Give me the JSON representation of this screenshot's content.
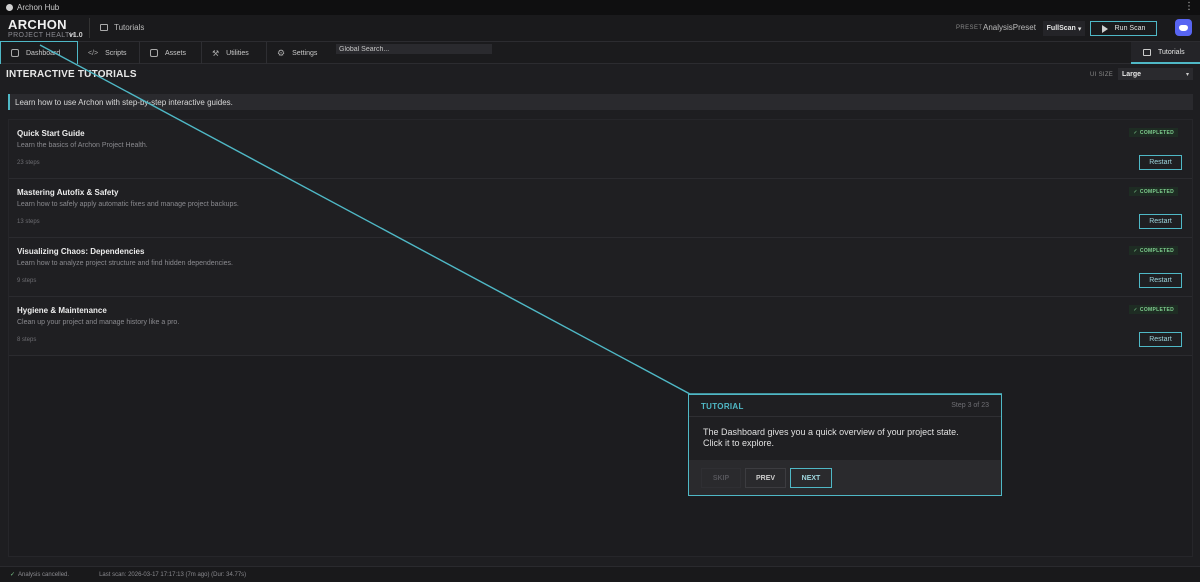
{
  "window": {
    "title": "Archon Hub",
    "menu_icon": "more-vert-icon"
  },
  "header": {
    "app_name": "ARCHON",
    "app_sub": "PROJECT HEALTH",
    "version": "v1.0",
    "breadcrumb": "Tutorials",
    "preset_label": "PRESET",
    "preset_value": "AnalysisPreset",
    "scan_mode": "FullScan",
    "run_scan_label": "Run Scan"
  },
  "nav": {
    "tabs": [
      {
        "label": "Dashboard",
        "icon": "dashboard-icon",
        "active": true
      },
      {
        "label": "Scripts",
        "icon": "code-icon"
      },
      {
        "label": "Assets",
        "icon": "cube-icon"
      },
      {
        "label": "Utilities",
        "icon": "wrench-icon"
      },
      {
        "label": "Settings",
        "icon": "gear-icon"
      }
    ],
    "search_placeholder": "Global Search...",
    "right_tab": "Tutorials"
  },
  "page": {
    "title": "INTERACTIVE TUTORIALS",
    "ui_size_label": "UI SIZE",
    "ui_size_value": "Large",
    "intro": "Learn how to use Archon with step-by-step interactive guides."
  },
  "tutorials": [
    {
      "title": "Quick Start Guide",
      "desc": "Learn the basics of Archon Project Health.",
      "steps": "23 steps",
      "status": "COMPLETED",
      "action": "Restart"
    },
    {
      "title": "Mastering Autofix & Safety",
      "desc": "Learn how to safely apply automatic fixes and manage project backups.",
      "steps": "13 steps",
      "status": "COMPLETED",
      "action": "Restart"
    },
    {
      "title": "Visualizing Chaos: Dependencies",
      "desc": "Learn how to analyze project structure and find hidden dependencies.",
      "steps": "9 steps",
      "status": "COMPLETED",
      "action": "Restart"
    },
    {
      "title": "Hygiene & Maintenance",
      "desc": "Clean up your project and manage history like a pro.",
      "steps": "8 steps",
      "status": "COMPLETED",
      "action": "Restart"
    }
  ],
  "popover": {
    "label": "TUTORIAL",
    "step": "Step 3 of 23",
    "body": "The Dashboard gives you a quick overview of your project state. Click it to explore.",
    "skip": "SKIP",
    "prev": "PREV",
    "next": "NEXT"
  },
  "status": {
    "message": "Analysis cancelled.",
    "last_scan": "Last scan: 2026-03-17 17:17:13 (7m ago) (Dur: 34.77s)"
  },
  "colors": {
    "accent": "#4fb8c6",
    "success": "#7fcf8f",
    "discord": "#5865f2"
  }
}
